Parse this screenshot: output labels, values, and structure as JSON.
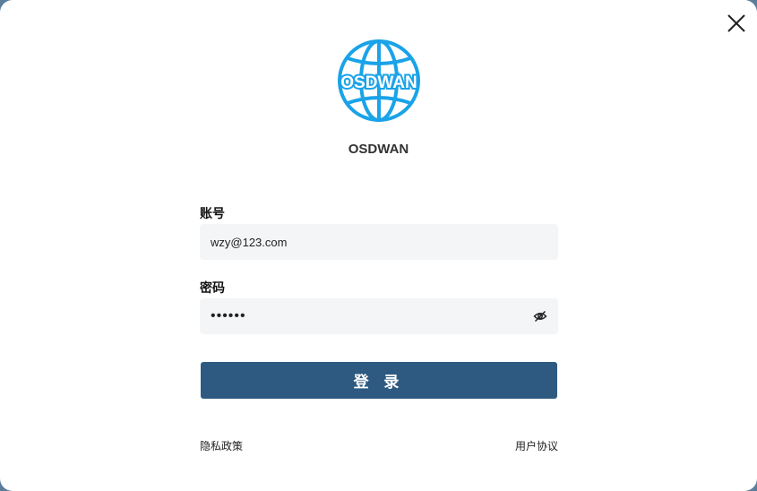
{
  "app": {
    "name": "OSDWAN",
    "logo_text": "OSDWAN",
    "brand_color": "#1aa3e8"
  },
  "form": {
    "account_label": "账号",
    "account_value": "wzy@123.com",
    "password_label": "密码",
    "password_value": "••••••"
  },
  "actions": {
    "login_label": "登 录"
  },
  "footer": {
    "privacy_label": "隐私政策",
    "agreement_label": "用户协议"
  },
  "icons": {
    "close": "close-icon",
    "eye": "eye-off-icon",
    "logo": "globe-icon"
  },
  "colors": {
    "primary_button": "#2e5a81",
    "input_background": "#f4f5f7"
  }
}
